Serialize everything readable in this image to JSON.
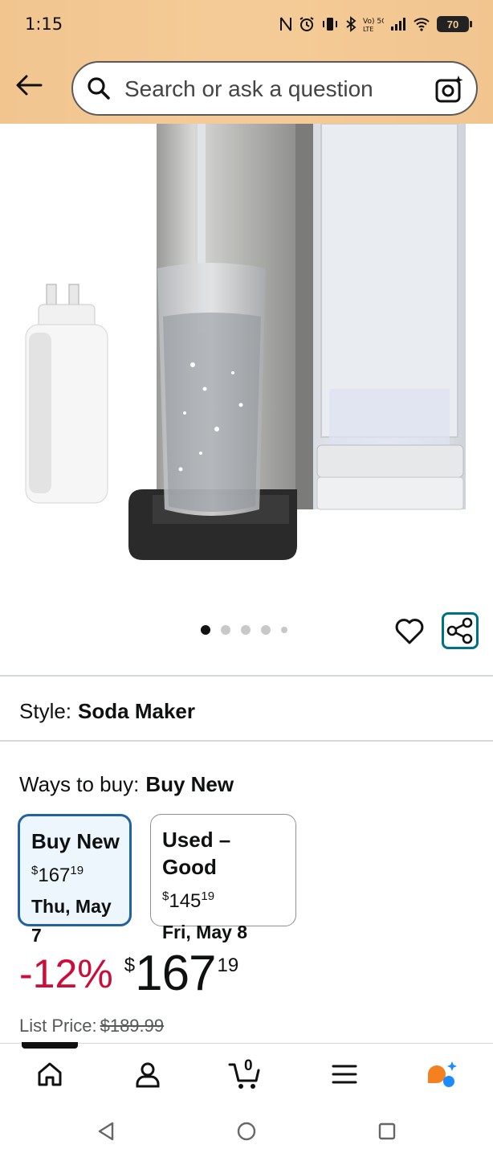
{
  "status_bar": {
    "time": "1:15",
    "icons": [
      "nfc-icon",
      "alarm-icon",
      "vibrate-icon",
      "bluetooth-icon",
      "volte-icon",
      "signal-icon",
      "wifi-icon"
    ],
    "battery": "70"
  },
  "header": {
    "search_placeholder": "Search or ask a question",
    "accent": "#f4cb97"
  },
  "gallery": {
    "dot_count": 5,
    "active_index": 0
  },
  "style": {
    "label": "Style:",
    "value": "Soda Maker"
  },
  "ways_to_buy": {
    "label": "Ways to buy:",
    "value": "Buy New",
    "options": [
      {
        "title": "Buy New",
        "currency": "$",
        "whole": "167",
        "fraction": "19",
        "date": "Thu, May 7"
      },
      {
        "title": "Used – Good",
        "currency": "$",
        "whole": "145",
        "fraction": "19",
        "date": "Fri, May 8"
      }
    ]
  },
  "price": {
    "discount": "-12%",
    "currency": "$",
    "whole": "167",
    "fraction": "19",
    "list_label": "List Price:",
    "list_value": "$189.99",
    "discount_color": "#cc0c39"
  },
  "bottom_nav": {
    "cart_count": "0",
    "items": [
      "home-icon",
      "account-icon",
      "cart-icon",
      "menu-icon",
      "rufus-icon"
    ]
  }
}
